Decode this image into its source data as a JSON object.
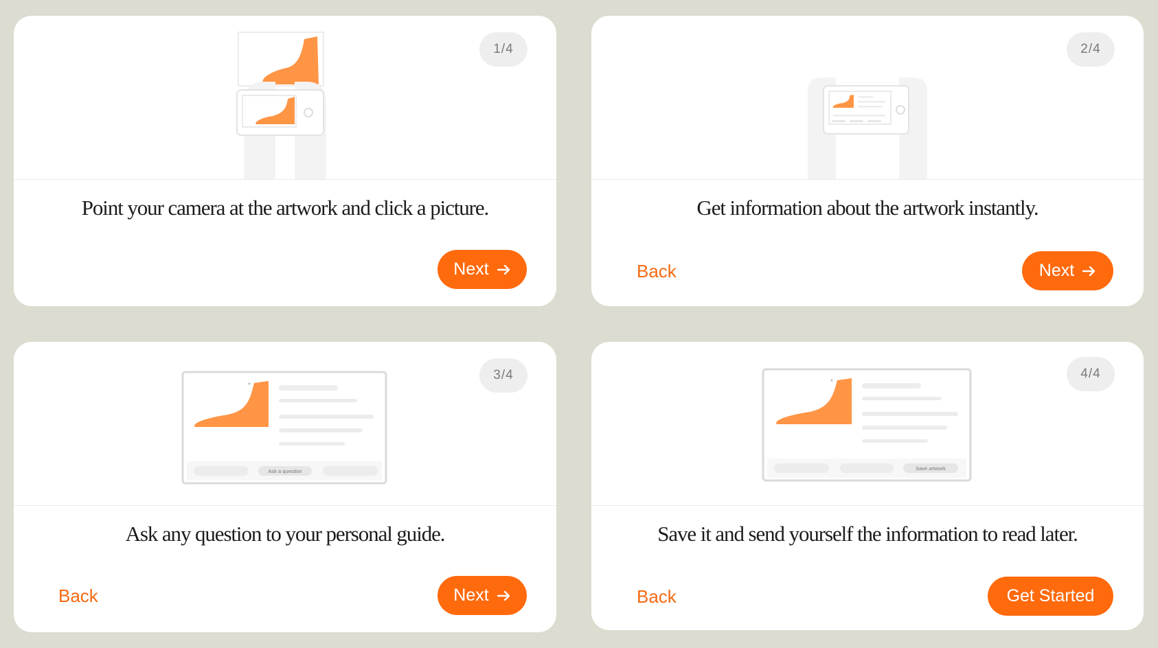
{
  "colors": {
    "background": "#dcddd0",
    "accent": "#ff6a0d",
    "card": "#ffffff"
  },
  "cards": [
    {
      "step": "1/4",
      "caption": "Point your camera at the artwork and click a picture.",
      "back_label": "",
      "primary_label": "Next",
      "primary_icon": "arrow-right-icon"
    },
    {
      "step": "2/4",
      "caption": "Get information about the artwork instantly.",
      "back_label": "Back",
      "primary_label": "Next",
      "primary_icon": "arrow-right-icon"
    },
    {
      "step": "3/4",
      "caption": "Ask any question to your personal guide.",
      "back_label": "Back",
      "primary_label": "Next",
      "primary_icon": "arrow-right-icon",
      "illustration_button": "Ask a question"
    },
    {
      "step": "4/4",
      "caption": "Save it and send yourself the information to read later.",
      "back_label": "Back",
      "primary_label": "Get Started",
      "illustration_button": "Save artwork"
    }
  ]
}
